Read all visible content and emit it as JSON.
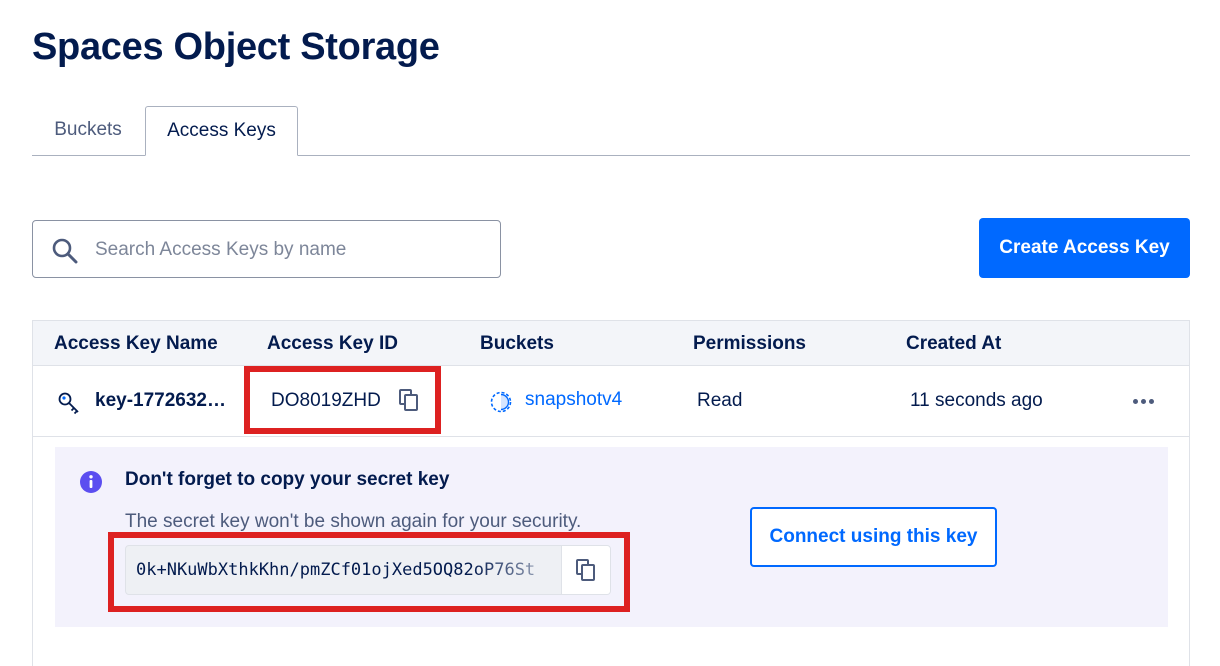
{
  "page": {
    "title": "Spaces Object Storage"
  },
  "tabs": [
    {
      "label": "Buckets",
      "active": false
    },
    {
      "label": "Access Keys",
      "active": true
    }
  ],
  "search": {
    "placeholder": "Search Access Keys by name",
    "value": ""
  },
  "toolbar": {
    "create_label": "Create Access Key"
  },
  "table": {
    "columns": [
      "Access Key Name",
      "Access Key ID",
      "Buckets",
      "Permissions",
      "Created At"
    ],
    "rows": [
      {
        "name": "key-1772632…",
        "id": "DO8019ZHD",
        "bucket": "snapshotv4",
        "permission": "Read",
        "created": "11 seconds ago"
      }
    ]
  },
  "notice": {
    "title": "Don't forget to copy your secret key",
    "text": "The secret key won't be shown again for your security.",
    "secret": "0k+NKuWbXthkKhn/pmZCf01ojXed5OQ82oP76St",
    "connect_label": "Connect using this key"
  },
  "colors": {
    "primary": "#0069ff",
    "heading": "#031b4e",
    "highlight": "#dd2121",
    "info": "#5b4ef0",
    "notice_bg": "#f3f2fc"
  },
  "icons": [
    "search-icon",
    "key-icon",
    "copy-icon",
    "bucket-icon",
    "more-icon",
    "info-icon"
  ]
}
